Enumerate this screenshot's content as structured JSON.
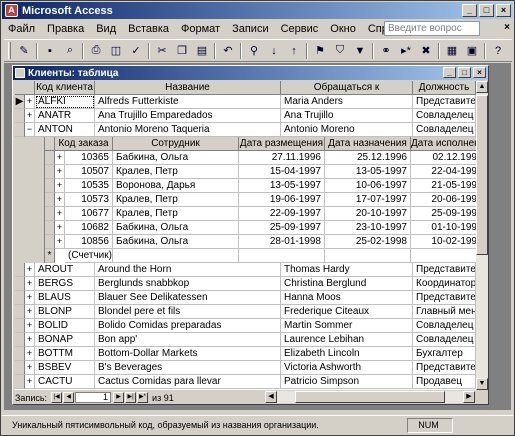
{
  "app": {
    "title": "Microsoft Access",
    "icon": "access-key-icon"
  },
  "menu": {
    "items": [
      "Файл",
      "Правка",
      "Вид",
      "Вставка",
      "Формат",
      "Записи",
      "Сервис",
      "Окно",
      "Справка"
    ],
    "help_placeholder": "Введите вопрос"
  },
  "toolbar": {
    "buttons": [
      "view-icon",
      "save-icon",
      "search-icon",
      "print-icon",
      "print-preview-icon",
      "spelling-icon",
      "cut-icon",
      "copy-icon",
      "paste-icon",
      "undo-icon",
      "insert-hyperlink-icon",
      "sort-ascending-icon",
      "sort-descending-icon",
      "filter-by-selection-icon",
      "filter-by-form-icon",
      "apply-filter-icon",
      "find-icon",
      "new-record-icon",
      "delete-record-icon",
      "database-window-icon",
      "new-object-icon",
      "help-icon"
    ]
  },
  "datasheet": {
    "title": "Клиенты: таблица",
    "columns": [
      "Код клиента",
      "Название",
      "Обращаться к",
      "Должность"
    ],
    "rows_top": [
      {
        "id": "ALFKI",
        "name": "Alfreds Futterkiste",
        "contact": "Maria Anders",
        "title": "Представитель"
      },
      {
        "id": "ANATR",
        "name": "Ana Trujillo Emparedados",
        "contact": "Ana Trujillo",
        "title": "Совладелец"
      },
      {
        "id": "ANTON",
        "name": "Antonio Moreno Taqueria",
        "contact": "Antonio Moreno",
        "title": "Совладелец"
      }
    ],
    "subdatasheet": {
      "columns": [
        "Код заказа",
        "Сотрудник",
        "Дата размещения",
        "Дата назначения",
        "Дата исполнени"
      ],
      "rows": [
        {
          "order": "10365",
          "employee": "Бабкина, Ольга",
          "placed": "27.11.1996",
          "due": "25.12.1996",
          "shipped": "02.12.199"
        },
        {
          "order": "10507",
          "employee": "Кралев, Петр",
          "placed": "15-04-1997",
          "due": "13-05-1997",
          "shipped": "22-04-199"
        },
        {
          "order": "10535",
          "employee": "Воронова, Дарья",
          "placed": "13-05-1997",
          "due": "10-06-1997",
          "shipped": "21-05-199"
        },
        {
          "order": "10573",
          "employee": "Кралев, Петр",
          "placed": "19-06-1997",
          "due": "17-07-1997",
          "shipped": "20-06-199"
        },
        {
          "order": "10677",
          "employee": "Кралев, Петр",
          "placed": "22-09-1997",
          "due": "20-10-1997",
          "shipped": "25-09-199"
        },
        {
          "order": "10682",
          "employee": "Бабкина, Ольга",
          "placed": "25-09-1997",
          "due": "23-10-1997",
          "shipped": "01-10-199"
        },
        {
          "order": "10856",
          "employee": "Бабкина, Ольга",
          "placed": "28-01-1998",
          "due": "25-02-1998",
          "shipped": "10-02-199"
        }
      ],
      "new_row_label": "(Счетчик)"
    },
    "rows_bottom": [
      {
        "id": "AROUT",
        "name": "Around the Horn",
        "contact": "Thomas Hardy",
        "title": "Представитель"
      },
      {
        "id": "BERGS",
        "name": "Berglunds snabbkop",
        "contact": "Christina Berglund",
        "title": "Координатор"
      },
      {
        "id": "BLAUS",
        "name": "Blauer See Delikatessen",
        "contact": "Hanna Moos",
        "title": "Представитель"
      },
      {
        "id": "BLONP",
        "name": "Blondel pere et fils",
        "contact": "Frederique Citeaux",
        "title": "Главный менедже"
      },
      {
        "id": "BOLID",
        "name": "Bolido Comidas preparadas",
        "contact": "Martin Sommer",
        "title": "Совладелец"
      },
      {
        "id": "BONAP",
        "name": "Bon app'",
        "contact": "Laurence Lebihan",
        "title": "Совладелец"
      },
      {
        "id": "BOTTM",
        "name": "Bottom-Dollar Markets",
        "contact": "Elizabeth Lincoln",
        "title": "Бухгалтер"
      },
      {
        "id": "BSBEV",
        "name": "B's Beverages",
        "contact": "Victoria Ashworth",
        "title": "Представитель"
      },
      {
        "id": "CACTU",
        "name": "Cactus Comidas para llevar",
        "contact": "Patricio Simpson",
        "title": "Продавец"
      }
    ],
    "nav": {
      "label": "Запись:",
      "current": "1",
      "of_label": "из 91"
    }
  },
  "status": {
    "text": "Уникальный пятисимвольный код, образуемый из названия организации.",
    "num": "NUM"
  }
}
